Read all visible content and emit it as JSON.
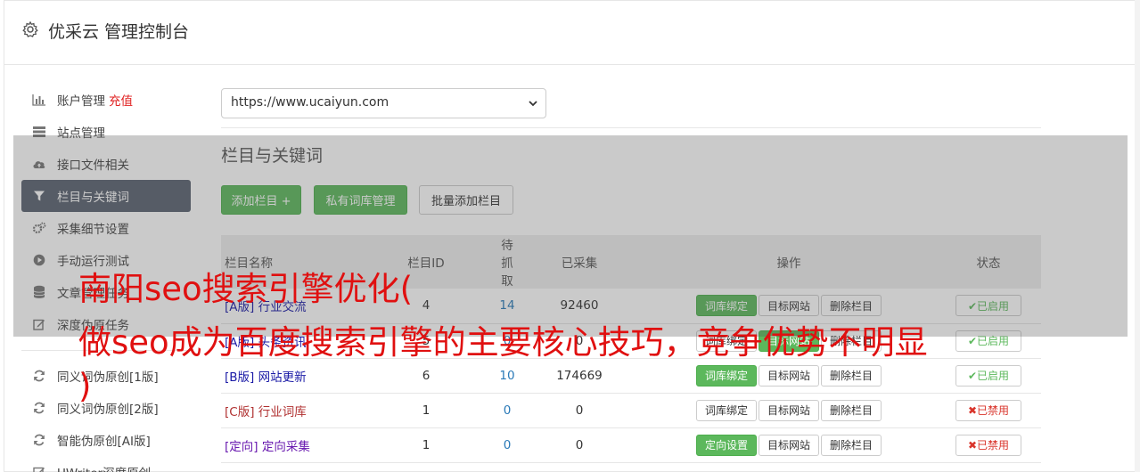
{
  "header": {
    "title": "优采云 管理控制台",
    "icon": "gear-icon"
  },
  "sidebar": {
    "items": [
      {
        "label": "账户管理",
        "extra": "充值",
        "icon": "bar-chart-icon"
      },
      {
        "label": "站点管理",
        "icon": "server-icon"
      },
      {
        "label": "接口文件相关",
        "icon": "cloud-upload-icon"
      },
      {
        "label": "栏目与关键词",
        "icon": "filter-icon"
      },
      {
        "label": "采集细节设置",
        "icon": "cogs-icon"
      },
      {
        "label": "手动运行测试",
        "icon": "play-circle-icon"
      },
      {
        "label": "文章管理任务",
        "icon": "database-icon"
      },
      {
        "label": "深度伪原任务",
        "icon": "edit-icon"
      }
    ],
    "tools": [
      {
        "label": "同义词伪原创[1版]",
        "icon": "refresh-icon"
      },
      {
        "label": "同义词伪原创[2版]",
        "icon": "refresh-icon"
      },
      {
        "label": "智能伪原创[AI版]",
        "icon": "refresh-icon"
      },
      {
        "label": "UWriter深度原创",
        "icon": "edit-icon"
      }
    ]
  },
  "site_select": {
    "value": "https://www.ucaiyun.com"
  },
  "section": {
    "title": "栏目与关键词",
    "buttons": {
      "add": "添加栏目 +",
      "private": "私有词库管理",
      "batch": "批量添加栏目"
    }
  },
  "table": {
    "headers": [
      "栏目名称",
      "栏目ID",
      "待抓取",
      "已采集",
      "操作",
      "状态"
    ],
    "rows": [
      {
        "tag": "[A版]",
        "name": "行业交流",
        "id": "4",
        "pending": "14",
        "collected": "92460",
        "op1": "词库绑定",
        "op2": "目标网站",
        "op3": "删除栏目",
        "status": "✔已启用"
      },
      {
        "tag": "[A版]",
        "name": "头条资讯",
        "id": "5",
        "pending": "0",
        "collected": "0",
        "op1": "词库绑定",
        "op2": "目标网站",
        "op3": "删除栏目",
        "status": "✔已启用"
      },
      {
        "tag": "[B版]",
        "name": "网站更新",
        "id": "6",
        "pending": "10",
        "collected": "174669",
        "op1": "词库绑定",
        "op2": "目标网站",
        "op3": "删除栏目",
        "status": "✔已启用"
      },
      {
        "tag": "[C版]",
        "name": "行业词库",
        "id": "1",
        "pending": "0",
        "collected": "0",
        "op1": "词库绑定",
        "op2": "目标网站",
        "op3": "删除栏目",
        "status": "✖已禁用"
      },
      {
        "tag": "[定向]",
        "name": "定向采集",
        "id": "1",
        "pending": "0",
        "collected": "0",
        "op1": "定向设置",
        "op2": "目标网站",
        "op3": "删除栏目",
        "status": "✖已禁用"
      }
    ]
  },
  "overlay_text": {
    "line1": "南阳seo搜索引擎优化(",
    "line2": "做seo成为百度搜索引擎的主要核心技巧，竞争优势不明显",
    "line3": ")"
  },
  "colors": {
    "accent_green": "#5cb85c",
    "active_side": "#5a6270",
    "overlay_red": "#e01010"
  }
}
